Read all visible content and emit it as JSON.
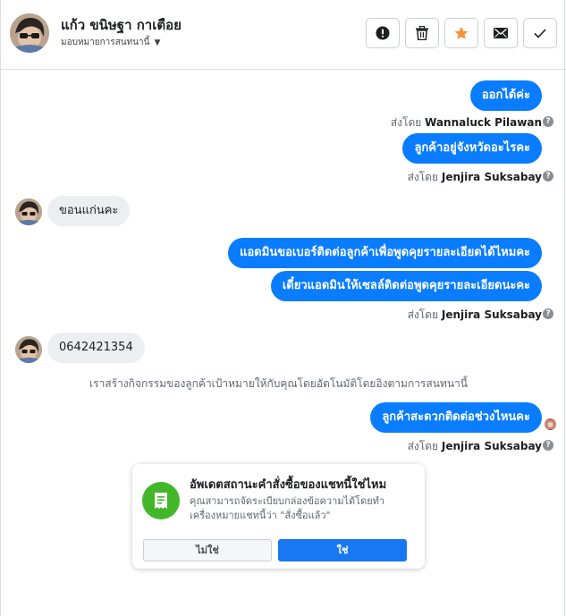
{
  "header": {
    "name": "แก้ว ขนิษฐา กาเตือย",
    "assign_label": "มอบหมายการสนทนานี้",
    "actions": {
      "report": "exclamation-icon",
      "delete": "trash-icon",
      "star": "star-icon",
      "unread": "envelope-icon",
      "done": "check-icon"
    },
    "star_color": "#f7923a"
  },
  "messages": [
    {
      "text": "ออกได้ค่ะ",
      "direction": "out"
    },
    {
      "sent_by_prefix": "ส่งโดย",
      "sender": "Wannaluck Pilawan"
    },
    {
      "text": "ลูกค้าอยู่จังหวัดอะไรคะ",
      "direction": "out"
    },
    {
      "sent_by_prefix": "ส่งโดย",
      "sender": "Jenjira Suksabay"
    },
    {
      "text": "ขอนแก่นคะ",
      "direction": "in"
    },
    {
      "text": "แอดมินขอเบอร์ติดต่อลูกค้าเพื่อพูดคุยรายละเอียดได้ไหมคะ",
      "direction": "out"
    },
    {
      "text": "เดี๋ยวแอดมินให้เซลล์ติดต่อพูดคุยรายละเอียดนะคะ",
      "direction": "out"
    },
    {
      "sent_by_prefix": "ส่งโดย",
      "sender": "Jenjira Suksabay"
    },
    {
      "text": "0642421354",
      "direction": "in"
    },
    {
      "system": "เราสร้างกิจกรรมของลูกค้าเป้าหมายให้กับคุณโดยอัตโนมัติโดยอิงตามการสนทนานี้"
    },
    {
      "text": "ลูกค้าสะดวกติดต่อช่วงไหนคะ",
      "direction": "out"
    },
    {
      "sent_by_prefix": "ส่งโดย",
      "sender": "Jenjira Suksabay"
    }
  ],
  "card": {
    "title": "อัพเดตสถานะคำสั่งซื้อของแชทนี้ใช่ไหม",
    "description": "คุณสามารถจัดระเบียบกล่องข้อความได้โดยทำเครื่องหมายแชทนี้ว่า \"สั่งซื้อแล้ว\"",
    "no_label": "ไม่ใช่",
    "yes_label": "ใช่",
    "icon": "receipt-icon"
  },
  "colors": {
    "outgoing_bubble": "#0a7cff",
    "incoming_bubble": "#eceef1",
    "yes_button": "#1877f2",
    "card_icon_bg": "#42b72a"
  },
  "help_glyph": "?"
}
